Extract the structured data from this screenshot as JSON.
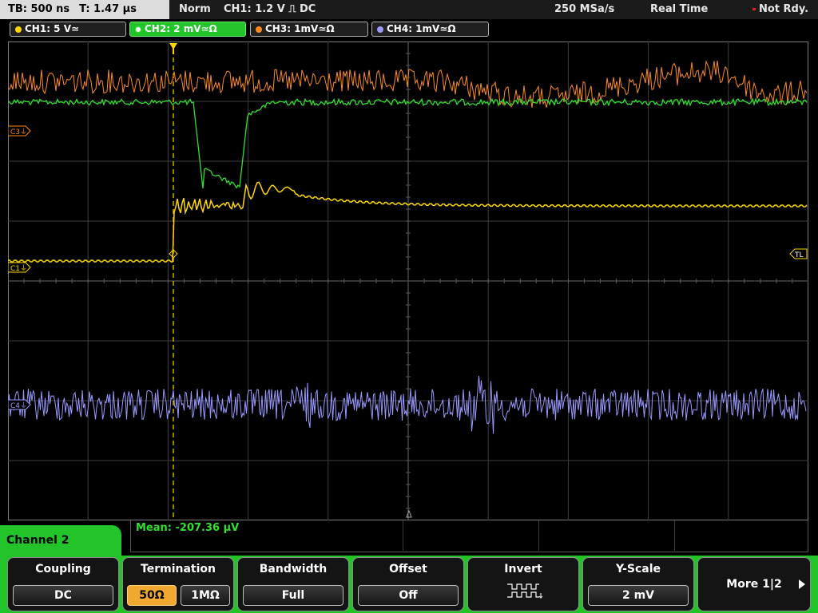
{
  "top": {
    "timebase": "TB: 500 ns",
    "trigger_time": "T: 1.47 µs",
    "mode": "Norm",
    "trigger": "CH1: 1.2 V ⎍ DC",
    "sample_rate": "250 MSa/s",
    "acq_mode": "Real Time",
    "status": "Not Rdy."
  },
  "channels": [
    {
      "label": "CH1: 5 V≃",
      "color": "#ffd700"
    },
    {
      "label": "CH2: 2 mV≃Ω",
      "color": "#2fe02f"
    },
    {
      "label": "CH3: 1mV≃Ω",
      "color": "#ff8c1a"
    },
    {
      "label": "CH4: 1mV≃Ω",
      "color": "#9999ff"
    }
  ],
  "markers": {
    "c3": "C3⏚",
    "c1": "C1⏚",
    "c4": "C4⏚",
    "tl": "TL"
  },
  "measurement": {
    "mean": "Mean: -207.36 µV"
  },
  "channel_panel": {
    "title": "Channel 2"
  },
  "softkeys": {
    "coupling": {
      "label": "Coupling",
      "value": "DC"
    },
    "termination": {
      "label": "Termination",
      "options": [
        "50Ω",
        "1MΩ"
      ],
      "selected": "50Ω"
    },
    "bandwidth": {
      "label": "Bandwidth",
      "value": "Full"
    },
    "offset": {
      "label": "Offset",
      "value": "Off"
    },
    "invert": {
      "label": "Invert",
      "icon": "inverted-square-wave-icon"
    },
    "yscale": {
      "label": "Y-Scale",
      "value": "2 mV"
    },
    "more": {
      "label": "More 1|2"
    }
  },
  "colors": {
    "ch1": "#ffd700",
    "ch2": "#2fe02f",
    "ch3": "#ff8c1a",
    "ch4": "#9999ff",
    "grid": "#4a4a4a",
    "active_tab": "#22c42a",
    "selected_option": "#f0a830"
  }
}
